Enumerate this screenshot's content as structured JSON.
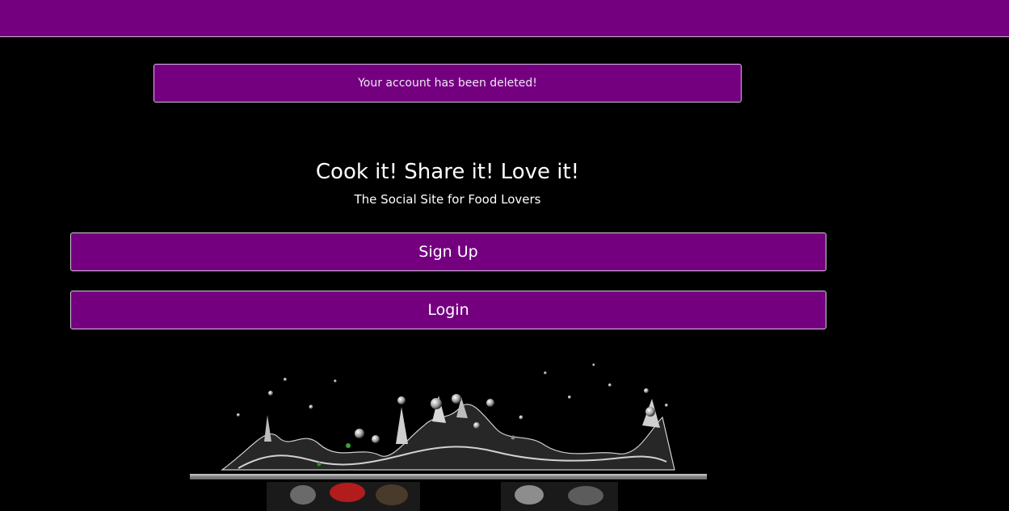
{
  "alert": {
    "message": "Your account has been deleted!"
  },
  "hero": {
    "title": "Cook it! Share it! Love it!",
    "subtitle": "The Social Site for Food Lovers"
  },
  "buttons": {
    "signup_label": "Sign Up",
    "login_label": "Login"
  },
  "colors": {
    "brand_purple": "#740080",
    "background": "#000000",
    "text": "#ffffff"
  }
}
